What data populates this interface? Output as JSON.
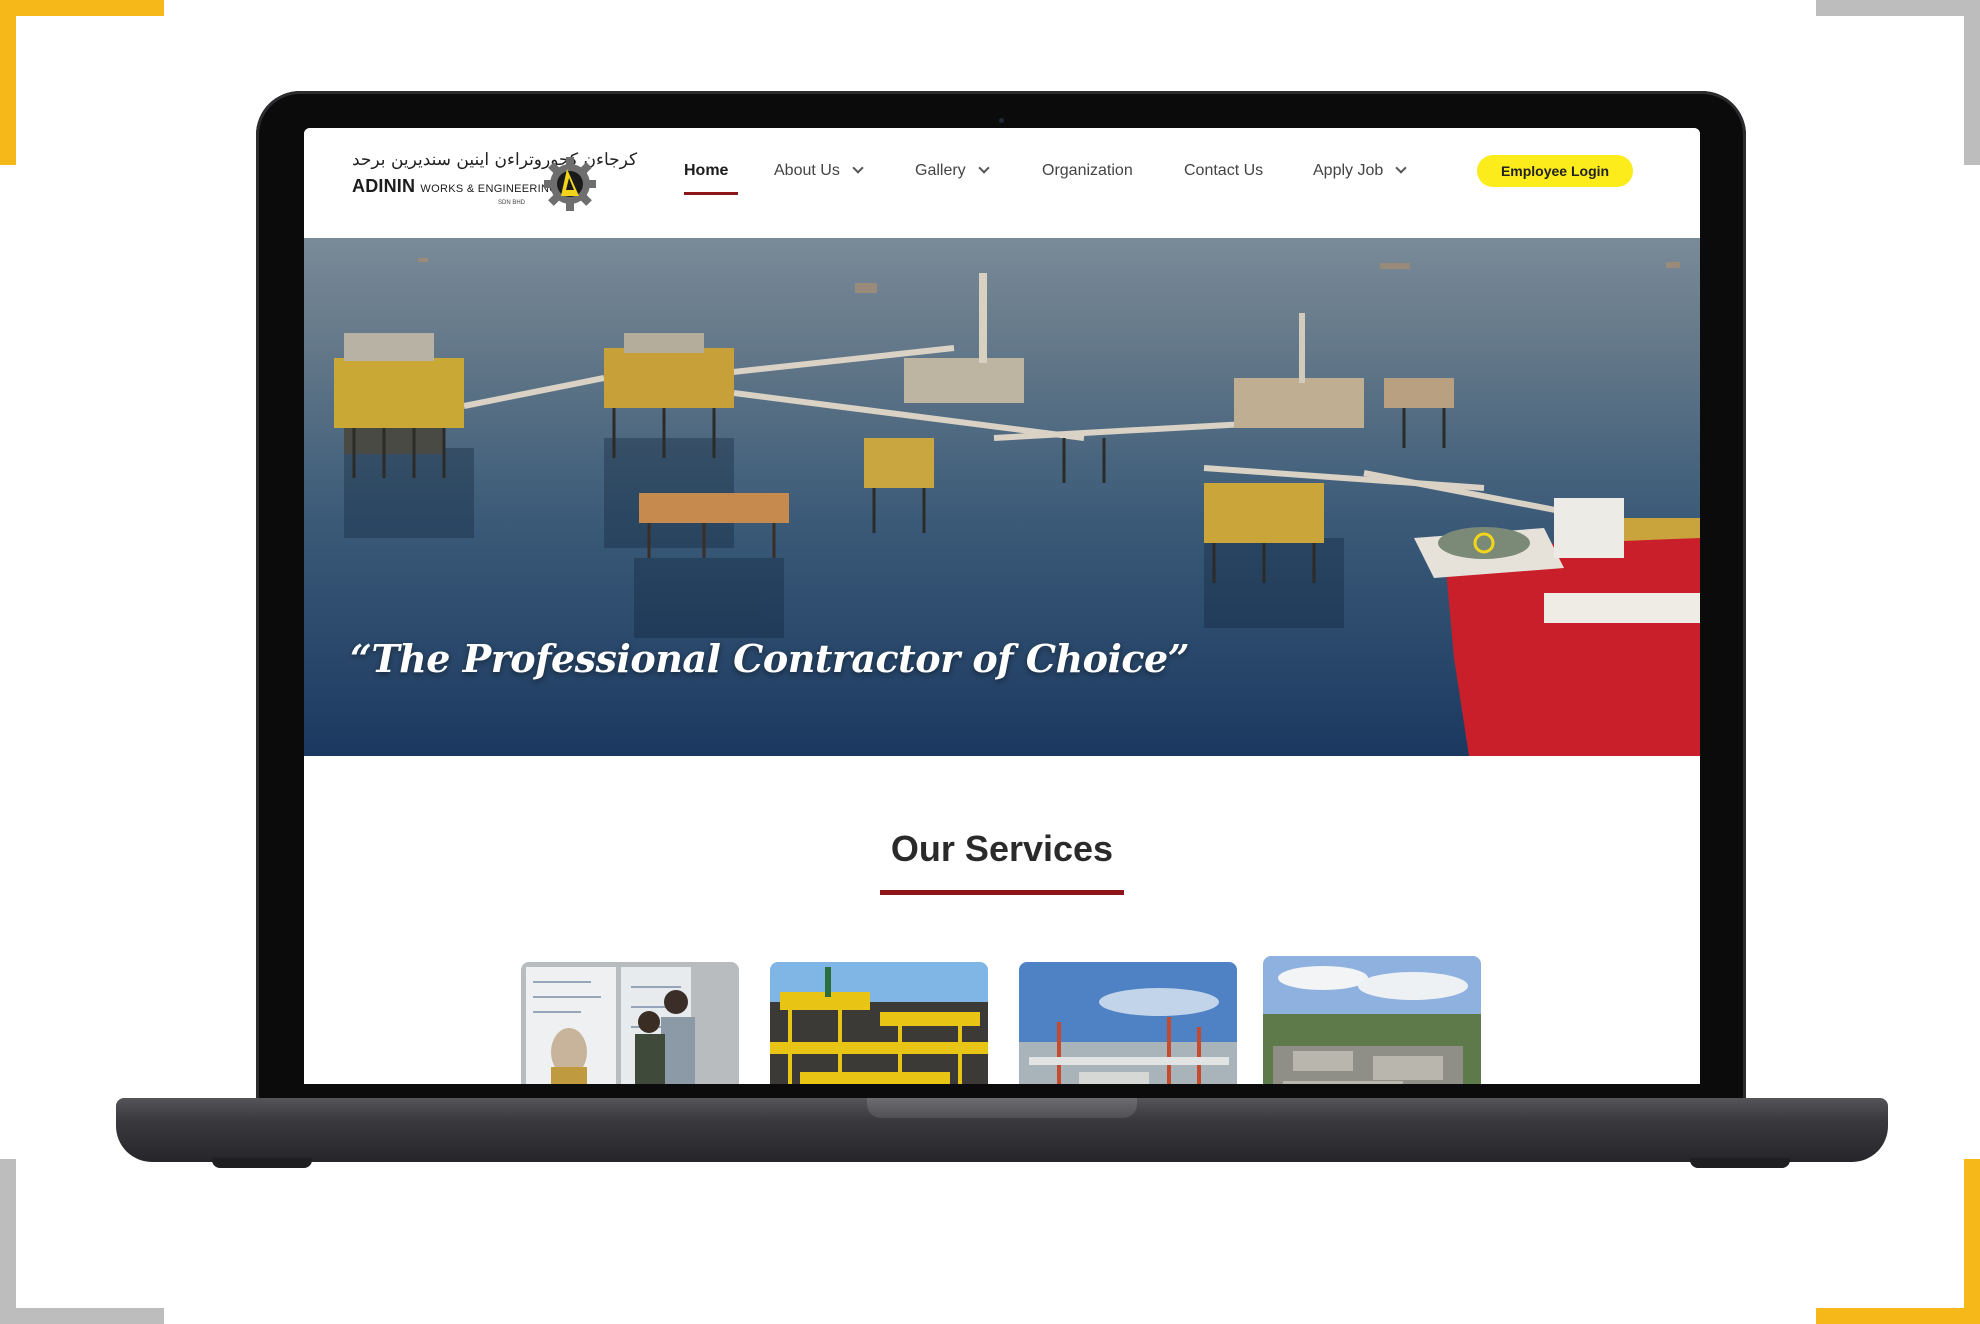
{
  "colors": {
    "accent_yellow": "#f6b818",
    "brand_red": "#8e1519",
    "login_button": "#fcec1c",
    "laptop_body": "#0b0b0c"
  },
  "logo": {
    "arabic_text": "کرجاءن کجوروتراءن اینین سنديرين برحد",
    "name": "ADININ",
    "subtitle": "WORKS & ENGINEERING",
    "suffix": "SDN BHD",
    "icon": "gear-logo-icon"
  },
  "nav": {
    "items": [
      {
        "label": "Home",
        "active": true,
        "dropdown": false
      },
      {
        "label": "About Us",
        "active": false,
        "dropdown": true
      },
      {
        "label": "Gallery",
        "active": false,
        "dropdown": true
      },
      {
        "label": "Organization",
        "active": false,
        "dropdown": false
      },
      {
        "label": "Contact Us",
        "active": false,
        "dropdown": false
      },
      {
        "label": "Apply Job",
        "active": false,
        "dropdown": true
      }
    ],
    "login_label": "Employee Login"
  },
  "hero": {
    "quote": "“The Professional Contractor of Choice”"
  },
  "services": {
    "title": "Our Services",
    "cards": [
      {
        "image": "office-meeting-photo"
      },
      {
        "image": "yellow-platform-photo"
      },
      {
        "image": "offshore-plant-photo"
      },
      {
        "image": "refinery-aerial-photo"
      }
    ]
  }
}
